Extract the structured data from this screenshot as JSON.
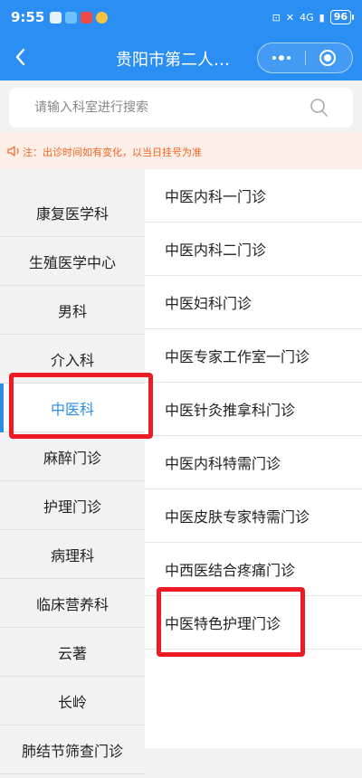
{
  "status_bar": {
    "time": "9:55",
    "network": "4G",
    "battery": "96"
  },
  "nav": {
    "title": "贵阳市第二人民医院"
  },
  "search": {
    "placeholder": "请输入科室进行搜索",
    "value": ""
  },
  "notice": {
    "text": "注：出诊时间如有变化，以当日挂号为准"
  },
  "departments": [
    "康复医学科",
    "生殖医学中心",
    "男科",
    "介入科",
    "中医科",
    "麻醉门诊",
    "护理门诊",
    "病理科",
    "临床营养科",
    "云著",
    "长岭",
    "肺结节筛查门诊"
  ],
  "selected_department": "中医科",
  "clinics": [
    "中医内科一门诊",
    "中医内科二门诊",
    "中医妇科门诊",
    "中医专家工作室一门诊",
    "中医针灸推拿科门诊",
    "中医内科特需门诊",
    "中医皮肤专家特需门诊",
    "中西医结合疼痛门诊",
    "中医特色护理门诊"
  ],
  "colors": {
    "header": "#2b8ef3",
    "active_text": "#2a8ee4",
    "notice_bg": "#fdeee8",
    "notice_text": "#f26522",
    "highlight": "#ee1b24"
  }
}
